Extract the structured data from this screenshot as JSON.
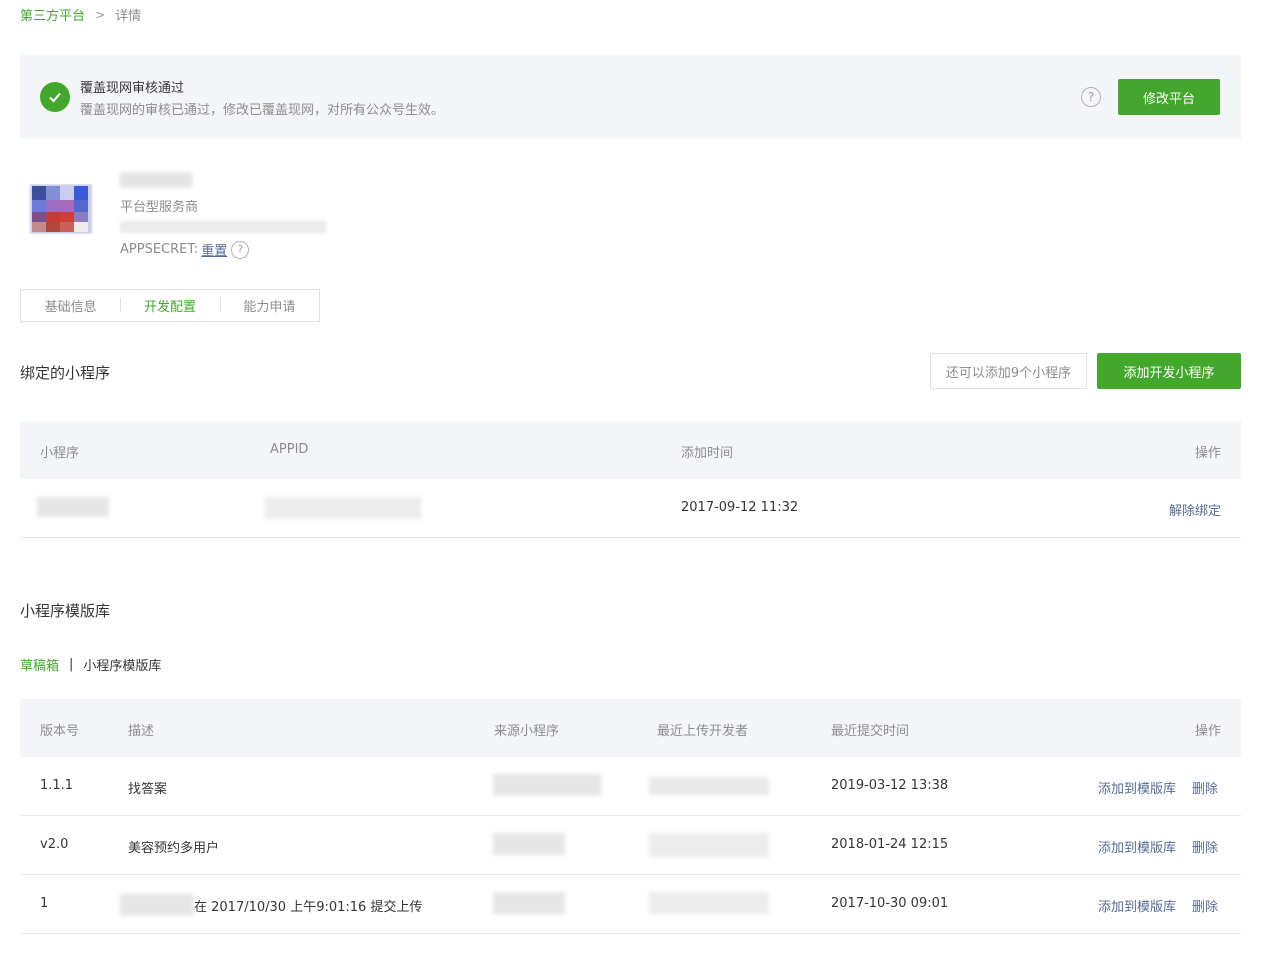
{
  "breadcrumb": {
    "parent": "第三方平台",
    "separator": ">",
    "current": "详情"
  },
  "notice": {
    "title": "覆盖现网审核通过",
    "desc": "覆盖现网的审核已通过，修改已覆盖现网，对所有公众号生效。",
    "help": "?",
    "button": "修改平台"
  },
  "profile": {
    "type": "平台型服务商",
    "secret_label": "APPSECRET:",
    "reset": "重置",
    "help": "?"
  },
  "tabs": [
    "基础信息",
    "开发配置",
    "能力申请"
  ],
  "bound": {
    "title": "绑定的小程序",
    "quota": "还可以添加9个小程序",
    "add_button": "添加开发小程序",
    "headers": [
      "小程序",
      "APPID",
      "添加时间",
      "操作"
    ],
    "rows": [
      {
        "time": "2017-09-12 11:32",
        "action": "解除绑定"
      }
    ]
  },
  "templates": {
    "title": "小程序模版库",
    "subtabs": [
      "草稿箱",
      "小程序模版库"
    ],
    "subtab_divider": "|",
    "headers": [
      "版本号",
      "描述",
      "来源小程序",
      "最近上传开发者",
      "最近提交时间",
      "操作"
    ],
    "rows": [
      {
        "version": "1.1.1",
        "desc": "找答案",
        "time": "2019-03-12 13:38",
        "add": "添加到模版库",
        "del": "删除"
      },
      {
        "version": "v2.0",
        "desc": "美容预约多用户",
        "time": "2018-01-24 12:15",
        "add": "添加到模版库",
        "del": "删除"
      },
      {
        "version": "1",
        "desc": "在 2017/10/30 上午9:01:16 提交上传",
        "time": "2017-10-30 09:01",
        "add": "添加到模版库",
        "del": "删除"
      }
    ]
  },
  "colors": {
    "accent": "#44a72d",
    "link": "#576b95",
    "muted": "#8d8d8d",
    "header_bg": "#f4f5f9"
  }
}
